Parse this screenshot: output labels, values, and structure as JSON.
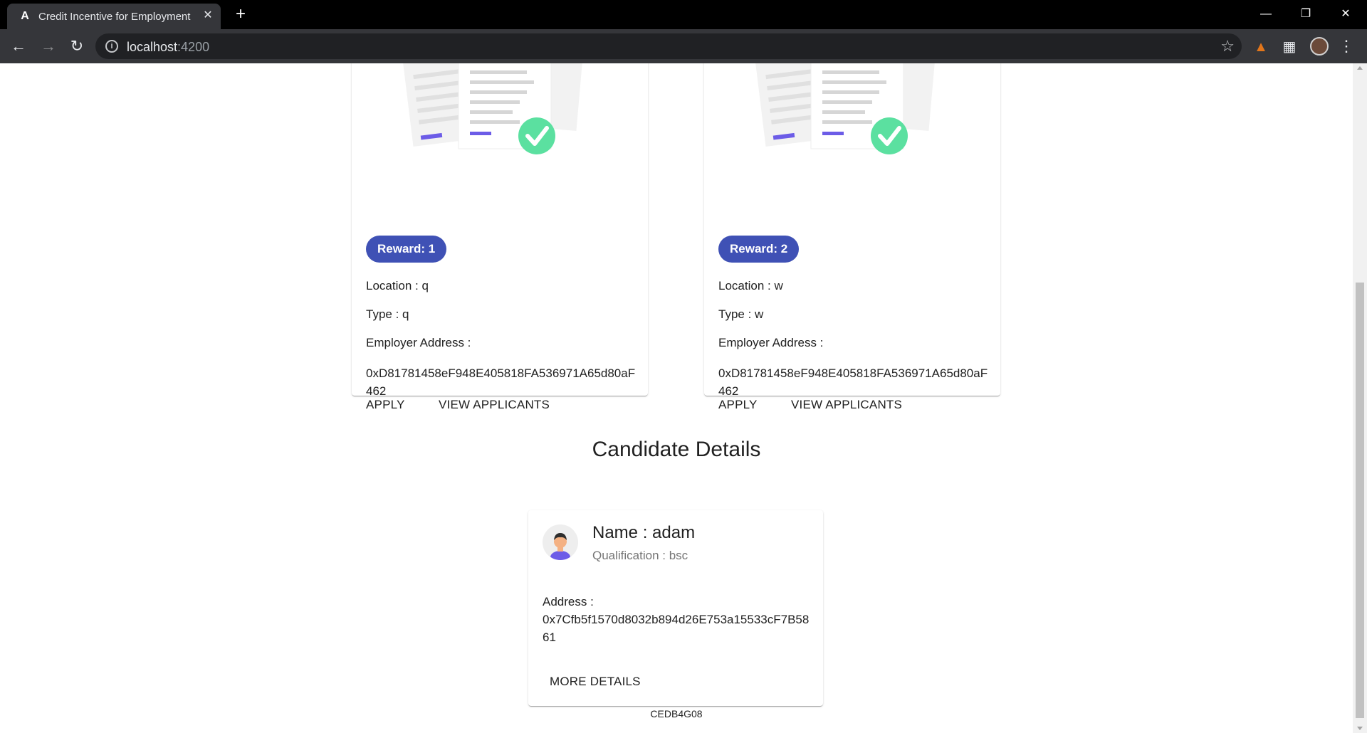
{
  "browser": {
    "tab_title": "Credit Incentive for Employment",
    "favicon": "A",
    "url_host": "localhost",
    "url_port": ":4200",
    "icons": [
      "back-icon",
      "forward-icon",
      "reload-icon",
      "info-icon",
      "star-icon",
      "metamask-icon",
      "extensions-icon",
      "profile-avatar",
      "menu-icon"
    ]
  },
  "jobs": [
    {
      "reward": "Reward: 1",
      "location": "Location : q",
      "type": "Type : q",
      "employer_label": "Employer Address :",
      "employer_address": "0xD81781458eF948E405818FA536971A65d80aF462",
      "apply_label": "APPLY",
      "view_label": "VIEW APPLICANTS"
    },
    {
      "reward": "Reward: 2",
      "location": "Location : w",
      "type": "Type : w",
      "employer_label": "Employer Address :",
      "employer_address": "0xD81781458eF948E405818FA536971A65d80aF462",
      "apply_label": "APPLY",
      "view_label": "VIEW APPLICANTS"
    }
  ],
  "candidates": {
    "section_title": "Candidate Details",
    "card": {
      "name": "Name : adam",
      "qualification": "Qualification : bsc",
      "address_label": "Address :",
      "address": "0x7Cfb5f1570d8032b894d26E753a15533cF7B5861",
      "more_label": "MORE DETAILS"
    }
  },
  "footer": {
    "code": "CEDB4G08"
  },
  "colors": {
    "accent": "#3f51b5",
    "check_green": "#5be0a0",
    "doc_bar": "#6c5ce7"
  }
}
